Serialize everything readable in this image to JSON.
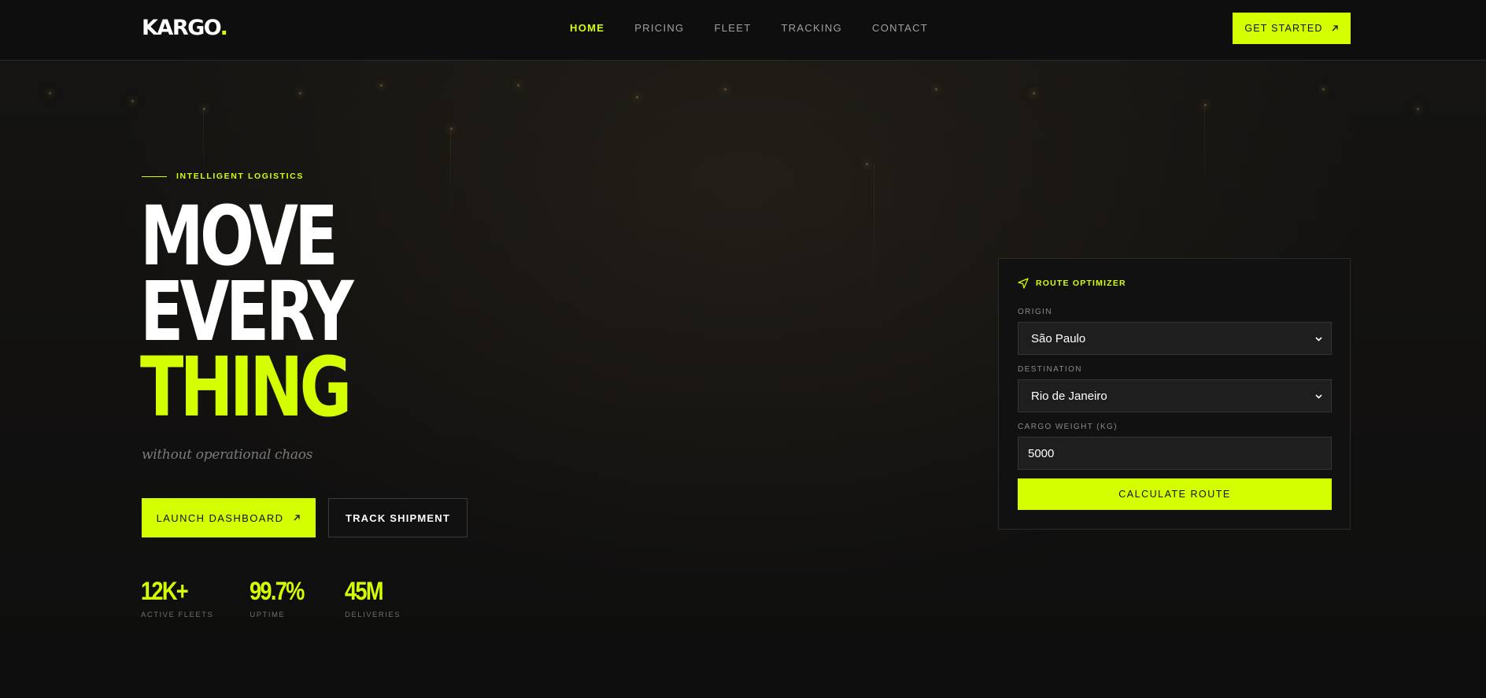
{
  "brand": {
    "name": "KARGO",
    "dot": ".",
    "accent_color": "#d4ff00"
  },
  "nav": {
    "items": [
      {
        "label": "HOME",
        "active": true
      },
      {
        "label": "PRICING",
        "active": false
      },
      {
        "label": "FLEET",
        "active": false
      },
      {
        "label": "TRACKING",
        "active": false
      },
      {
        "label": "CONTACT",
        "active": false
      }
    ],
    "cta_label": "GET STARTED",
    "cta_icon": "arrow-up-right-icon"
  },
  "hero": {
    "eyebrow": "INTELLIGENT LOGISTICS",
    "headline": [
      "MOVE",
      "EVERY",
      "THING"
    ],
    "tagline": "without operational chaos",
    "primary_button": "LAUNCH DASHBOARD",
    "secondary_button": "TRACK SHIPMENT",
    "stats": [
      {
        "value": "12K+",
        "label": "ACTIVE FLEETS"
      },
      {
        "value": "99.7%",
        "label": "UPTIME"
      },
      {
        "value": "45M",
        "label": "DELIVERIES"
      }
    ]
  },
  "route_optimizer": {
    "title": "ROUTE OPTIMIZER",
    "title_icon": "navigation-icon",
    "origin_label": "ORIGIN",
    "origin_value": "São Paulo",
    "destination_label": "DESTINATION",
    "destination_value": "Rio de Janeiro",
    "weight_label": "CARGO WEIGHT (KG)",
    "weight_value": "5000",
    "submit_label": "CALCULATE ROUTE"
  }
}
